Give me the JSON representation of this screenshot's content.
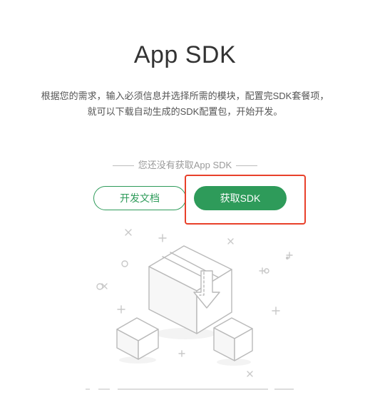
{
  "header": {
    "title": "App SDK",
    "description_line1": "根据您的需求，输入必须信息并选择所需的模块，配置完SDK套餐项，",
    "description_line2": "就可以下载自动生成的SDK配置包，开始开发。"
  },
  "status": {
    "text": "您还没有获取App SDK"
  },
  "actions": {
    "docs_label": "开发文档",
    "get_sdk_label": "获取SDK"
  },
  "colors": {
    "accent": "#2e9b5a",
    "highlight": "#e8402a",
    "illustration_stroke": "#b9b9b9",
    "text_primary": "#333333",
    "text_secondary": "#555555",
    "text_muted": "#9a9a9a"
  },
  "illustration": {
    "icon": "box-download-illustration"
  }
}
